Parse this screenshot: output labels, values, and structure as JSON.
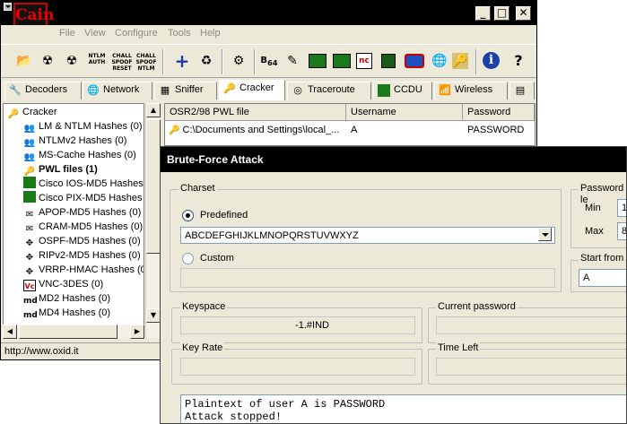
{
  "window": {
    "logo_text": "Cain",
    "min_glyph": "_",
    "max_glyph": "□",
    "close_glyph": "✕"
  },
  "menu": [
    "File",
    "View",
    "Configure",
    "Tools",
    "Help"
  ],
  "toolbar": {
    "ntlm_auth_label": "NTLM AUTH",
    "challenge_spoof_reset_label": "CHALL SPOOF RESET",
    "challenge_spoof_ntlm_label": "CHALL SPOOF NTLM",
    "base64_label": "64"
  },
  "tabs": [
    "Decoders",
    "Network",
    "Sniffer",
    "Cracker",
    "Traceroute",
    "CCDU",
    "Wireless"
  ],
  "tree": {
    "root": "Cracker",
    "items": [
      {
        "label": "LM & NTLM Hashes (0)",
        "icon": "user-group-icon"
      },
      {
        "label": "NTLMv2 Hashes (0)",
        "icon": "user-group-icon"
      },
      {
        "label": "MS-Cache Hashes (0)",
        "icon": "user-group-icon"
      },
      {
        "label": "PWL files (1)",
        "icon": "key-icon"
      },
      {
        "label": "Cisco IOS-MD5 Hashes (",
        "icon": "router-icon"
      },
      {
        "label": "Cisco PIX-MD5 Hashes (",
        "icon": "router-icon"
      },
      {
        "label": "APOP-MD5 Hashes (0)",
        "icon": "mail-icon"
      },
      {
        "label": "CRAM-MD5 Hashes (0)",
        "icon": "mail-icon"
      },
      {
        "label": "OSPF-MD5 Hashes (0)",
        "icon": "crosshair-icon"
      },
      {
        "label": "RIPv2-MD5 Hashes (0)",
        "icon": "crosshair-icon"
      },
      {
        "label": "VRRP-HMAC Hashes (0)",
        "icon": "crosshair-icon"
      },
      {
        "label": "VNC-3DES (0)",
        "icon": "vnc-icon"
      },
      {
        "label": "MD2 Hashes (0)",
        "icon": "md2-icon"
      },
      {
        "label": "MD4 Hashes (0)",
        "icon": "md4-icon"
      }
    ]
  },
  "list": {
    "columns": [
      "OSR2/98 PWL file",
      "Username",
      "Password"
    ],
    "rows": [
      {
        "file": "C:\\Documents and Settings\\local_...",
        "username": "A",
        "password": "PASSWORD"
      }
    ]
  },
  "statusbar": "http://www.oxid.it",
  "dialog": {
    "title": "Brute-Force Attack",
    "charset_label": "Charset",
    "predefined_label": "Predefined",
    "charset_value": "ABCDEFGHIJKLMNOPQRSTUVWXYZ",
    "custom_label": "Custom",
    "custom_value": "",
    "password_length_label": "Password le",
    "min_label": "Min",
    "min_value": "1",
    "max_label": "Max",
    "max_value": "8",
    "start_from_label": "Start from",
    "start_from_value": "A",
    "keyspace_label": "Keyspace",
    "keyspace_value": "-1.#IND",
    "current_password_label": "Current password",
    "current_password_value": "",
    "key_rate_label": "Key Rate",
    "key_rate_value": "",
    "time_left_label": "Time Left",
    "time_left_value": "",
    "output_lines": [
      "Plaintext of user A is PASSWORD",
      "Attack stopped!"
    ]
  }
}
